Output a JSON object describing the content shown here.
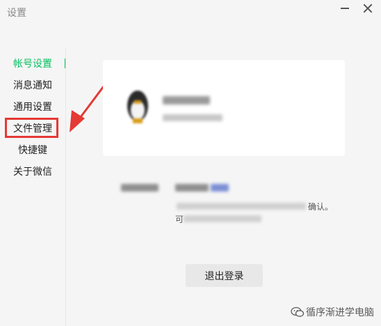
{
  "window": {
    "title": "设置"
  },
  "sidebar": {
    "items": [
      {
        "label": "帐号设置",
        "active": true
      },
      {
        "label": "消息通知",
        "active": false
      },
      {
        "label": "通用设置",
        "active": false
      },
      {
        "label": "文件管理",
        "active": false,
        "highlighted": true
      },
      {
        "label": "快捷键",
        "active": false
      },
      {
        "label": "关于微信",
        "active": false
      }
    ]
  },
  "account": {
    "note_partial_end": "确认。",
    "note_partial_start": "可"
  },
  "actions": {
    "logout_label": "退出登录"
  },
  "watermark": {
    "text": "循序渐进学电脑",
    "icon": "wechat-bubble-icon"
  },
  "colors": {
    "accent": "#07c160",
    "annotation": "#e53935",
    "background": "#f5f5f5",
    "card": "#ffffff"
  }
}
